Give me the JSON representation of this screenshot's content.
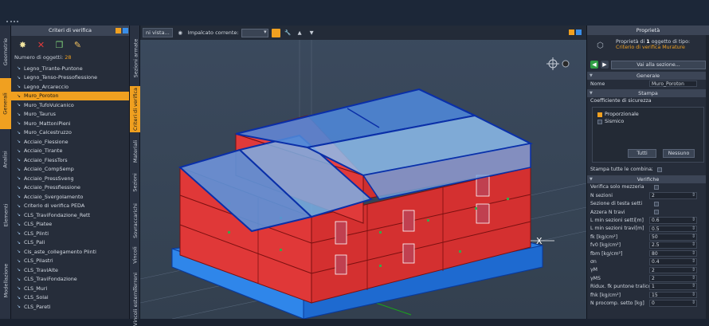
{
  "colors": {
    "accent": "#f0a020",
    "wall_red": "#e03535",
    "slab_blue": "#2a7de0",
    "roof_blue": "#5a8fd8"
  },
  "left_rail": {
    "tabs": [
      "Geometrie",
      "Generali",
      "Analisi",
      "Elementi",
      "Modellazione"
    ]
  },
  "criteria_panel": {
    "title": "Criteri di verifica",
    "count_label": "Numero di oggetti:",
    "count_value": "28",
    "items": [
      "Legno_Tirante-Puntone",
      "Legno_Tenso-Pressoflessione",
      "Legno_Arcareccio",
      "Muro_Poroton",
      "Muro_TufoVulcanico",
      "Muro_Taurus",
      "Muro_MattoniPieni",
      " Muro_Calcestruzzo",
      "Acciaio_Flessione",
      "Acciaio_Tirante",
      "Acciaio_FlessTors",
      "Acciaio_CompSemp",
      "Acciaio_PressSveng",
      "Acciaio_Pressflessione",
      "Acciaio_Svergolamento",
      "Criterio di verifica PEDA",
      " CLS_TraviFondazione_Rett",
      "CLS_Platee",
      "CLS_Plinti",
      "CLS_Pali",
      " Cls_aste_collegamento Plinti",
      "CLS_Pilastri",
      "CLS_TraviAlte",
      "CLS_TraviFondazione",
      "CLS_Muri",
      "CLS_Solai",
      "CLS_Pareti"
    ],
    "selected_index": 3
  },
  "mid_rail": {
    "tabs": [
      "Sezioni armate",
      "Criteri di verifica",
      "Materiali",
      "Sezioni",
      "Sovraccarichi",
      "Vincoli",
      "Terreni",
      "Vincoli esterni"
    ]
  },
  "viewport": {
    "view_label": "ni vista...",
    "floor_label": "Impalcato corrente:",
    "axis_x": "X"
  },
  "properties": {
    "title": "Proprietà",
    "info_prefix": "Proprietà di",
    "info_count": "1",
    "info_suffix": "oggetto di tipo:",
    "info_type": "Criterio di verifica Murature",
    "goto_label": "Vai alla sezione...",
    "section_general": "Generale",
    "name_label": "Nome",
    "name_value": "Muro_Poroton",
    "section_print": "Stampa",
    "safety_label": "Coefficiente di sicurezza",
    "safety_options": [
      {
        "label": "Proporzionale",
        "checked": true
      },
      {
        "label": "Sismico",
        "checked": false
      }
    ],
    "btn_all": "Tutti",
    "btn_none": "Nessuno",
    "print_all_label": "Stampa tutte le combinazioni",
    "section_checks": "Verifiche",
    "rows": [
      {
        "k": "Verifica solo mezzeria",
        "type": "check"
      },
      {
        "k": "N sezioni",
        "v": "2"
      },
      {
        "k": "Sezione di testa setti",
        "type": "check"
      },
      {
        "k": "Azzera N travi",
        "type": "check"
      },
      {
        "k": "L min sezioni setti[m]",
        "v": "0.6"
      },
      {
        "k": "L min sezioni travi[m]",
        "v": "0.5"
      },
      {
        "k": "fk [kg/cm²]",
        "v": "50"
      },
      {
        "k": "fv0 [kg/cm²]",
        "v": "2.5"
      },
      {
        "k": "fbm [kg/cm²]",
        "v": "80"
      },
      {
        "k": "σn",
        "v": "0.4"
      },
      {
        "k": "γM",
        "v": "2"
      },
      {
        "k": "γMS",
        "v": "2"
      },
      {
        "k": "Ridux. fk puntone traliccio",
        "v": "1"
      },
      {
        "k": "fhk [kg/cm²]",
        "v": "15"
      },
      {
        "k": "N procomp. setto [kg]",
        "v": "0"
      }
    ]
  }
}
